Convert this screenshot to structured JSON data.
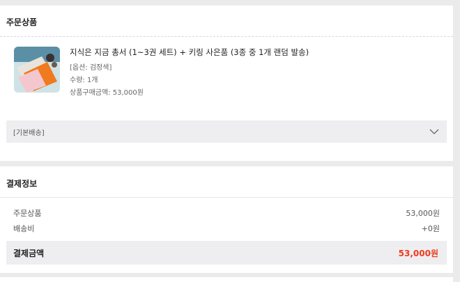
{
  "order": {
    "title": "주문상품",
    "product": {
      "name": "지식은 지금 총서 (1~3권 세트) + 키링 사은품 (3종 중 1개 랜덤 발송)",
      "option": "[옵션: 검정색]",
      "quantity": "수량: 1개",
      "purchase_amount": "상품구매금액: 53,000원"
    },
    "shipping_label": "[기본배송]",
    "chevron_icon": "chevron-down-icon"
  },
  "payment": {
    "title": "결제정보",
    "rows": [
      {
        "label": "주문상품",
        "value": "53,000원"
      },
      {
        "label": "배송비",
        "value": "+0원"
      }
    ],
    "total_label": "결제금액",
    "total_value": "53,000원"
  },
  "colors": {
    "background": "#ebebeb",
    "panel": "#ffffff",
    "bar": "#eeeef0",
    "accent": "#ee3b1f"
  }
}
